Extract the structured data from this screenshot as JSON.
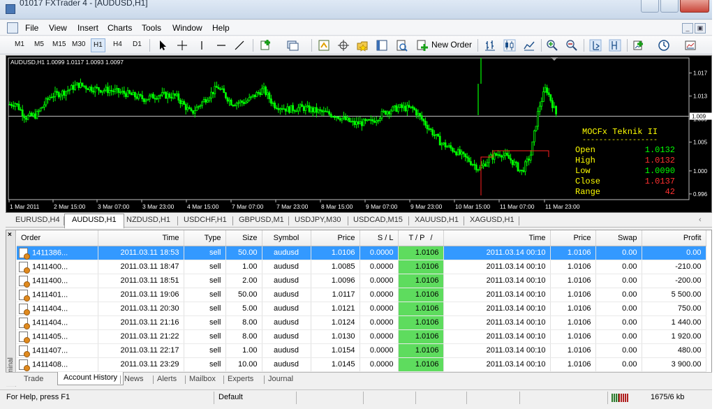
{
  "window": {
    "title": "01017 FXTrader 4 - [AUDUSD,H1]"
  },
  "menu": [
    "File",
    "View",
    "Insert",
    "Charts",
    "Tools",
    "Window",
    "Help"
  ],
  "toolbar": {
    "timeframes": [
      "M1",
      "M5",
      "M15",
      "M30",
      "H1",
      "H4",
      "D1"
    ],
    "active_timeframe": "H1",
    "new_order_label": "New Order"
  },
  "chart": {
    "header": "AUDUSD,H1  1.0099 1.0117 1.0093 1.0097",
    "price_ticks": [
      "1.017",
      "1.013",
      "1.009",
      "1.005",
      "1.000",
      "0.996"
    ],
    "current_price": "1.009",
    "time_ticks": [
      "1 Mar 2011",
      "2 Mar 15:00",
      "3 Mar 07:00",
      "3 Mar 23:00",
      "4 Mar 15:00",
      "7 Mar 07:00",
      "7 Mar 23:00",
      "8 Mar 15:00",
      "9 Mar 07:00",
      "9 Mar 23:00",
      "10 Mar 15:00",
      "11 Mar 07:00",
      "11 Mar 23:00"
    ],
    "colors": {
      "background": "#000000",
      "candles": "#00ff00",
      "info_title": "#ffff00",
      "up_value": "#00ff00",
      "down_value": "#ff3030"
    },
    "info_panel": {
      "title": "MOCFx Teknik II",
      "divider": "------------------",
      "rows": [
        {
          "label": "Open",
          "value": "1.0132",
          "color": "#00ff00"
        },
        {
          "label": "High",
          "value": "1.0132",
          "color": "#ff3030"
        },
        {
          "label": "Low",
          "value": "1.0090",
          "color": "#00ff00"
        },
        {
          "label": "Close",
          "value": "1.0137",
          "color": "#ff3030"
        },
        {
          "label": "Range",
          "value": "42",
          "color": "#ff3030"
        }
      ]
    }
  },
  "symbol_tabs": [
    "EURUSD,H4",
    "AUDUSD,H1",
    "NZDUSD,H1",
    "USDCHF,H1",
    "GBPUSD,M1",
    "USDJPY,M30",
    "USDCAD,M15",
    "XAUUSD,H1",
    "XAGUSD,H1"
  ],
  "active_symbol_tab": "AUDUSD,H1",
  "terminal": {
    "side_title": "Terminal",
    "columns": [
      "Order",
      "Time",
      "Type",
      "Size",
      "Symbol",
      "Price",
      "S / L",
      "T / P",
      "Time",
      "Price",
      "Swap",
      "Profit"
    ],
    "sort_indicator": "/",
    "rows": [
      [
        "1411386...",
        "2011.03.11 18:53",
        "sell",
        "50.00",
        "audusd",
        "1.0106",
        "0.0000",
        "1.0106",
        "2011.03.14 00:10",
        "1.0106",
        "0.00",
        "0.00"
      ],
      [
        "1411400...",
        "2011.03.11 18:47",
        "sell",
        "1.00",
        "audusd",
        "1.0085",
        "0.0000",
        "1.0106",
        "2011.03.14 00:10",
        "1.0106",
        "0.00",
        "-210.00"
      ],
      [
        "1411400...",
        "2011.03.11 18:51",
        "sell",
        "2.00",
        "audusd",
        "1.0096",
        "0.0000",
        "1.0106",
        "2011.03.14 00:10",
        "1.0106",
        "0.00",
        "-200.00"
      ],
      [
        "1411401...",
        "2011.03.11 19:06",
        "sell",
        "50.00",
        "audusd",
        "1.0117",
        "0.0000",
        "1.0106",
        "2011.03.14 00:10",
        "1.0106",
        "0.00",
        "5 500.00"
      ],
      [
        "1411404...",
        "2011.03.11 20:30",
        "sell",
        "5.00",
        "audusd",
        "1.0121",
        "0.0000",
        "1.0106",
        "2011.03.14 00:10",
        "1.0106",
        "0.00",
        "750.00"
      ],
      [
        "1411404...",
        "2011.03.11 21:16",
        "sell",
        "8.00",
        "audusd",
        "1.0124",
        "0.0000",
        "1.0106",
        "2011.03.14 00:10",
        "1.0106",
        "0.00",
        "1 440.00"
      ],
      [
        "1411405...",
        "2011.03.11 21:22",
        "sell",
        "8.00",
        "audusd",
        "1.0130",
        "0.0000",
        "1.0106",
        "2011.03.14 00:10",
        "1.0106",
        "0.00",
        "1 920.00"
      ],
      [
        "1411407...",
        "2011.03.11 22:17",
        "sell",
        "1.00",
        "audusd",
        "1.0154",
        "0.0000",
        "1.0106",
        "2011.03.14 00:10",
        "1.0106",
        "0.00",
        "480.00"
      ],
      [
        "1411408...",
        "2011.03.11 23:29",
        "sell",
        "10.00",
        "audusd",
        "1.0145",
        "0.0000",
        "1.0106",
        "2011.03.14 00:10",
        "1.0106",
        "0.00",
        "3 900.00"
      ]
    ],
    "tabs": [
      "Trade",
      "Account History",
      "News",
      "Alerts",
      "Mailbox",
      "Experts",
      "Journal"
    ],
    "active_tab": "Account History"
  },
  "status": {
    "help": "For Help, press F1",
    "profile": "Default",
    "traffic": "1675/6 kb"
  }
}
